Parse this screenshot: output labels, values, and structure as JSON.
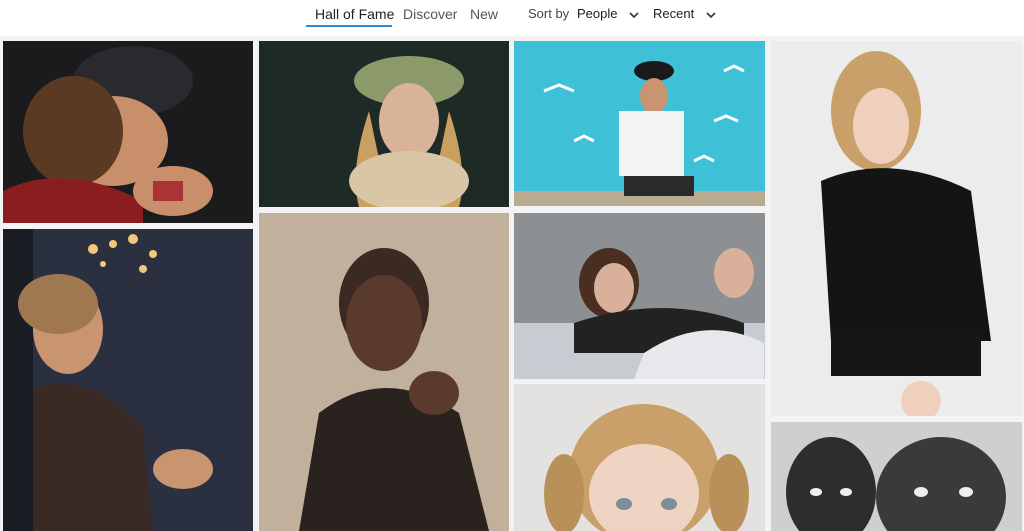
{
  "nav": {
    "tabs": [
      {
        "label": "Hall of Fame"
      },
      {
        "label": "Discover"
      },
      {
        "label": "New"
      }
    ],
    "active_tab": "Hall of Fame"
  },
  "sort": {
    "label": "Sort by",
    "category": "People",
    "period": "Recent"
  },
  "colors": {
    "accent": "#2a8bd8"
  }
}
